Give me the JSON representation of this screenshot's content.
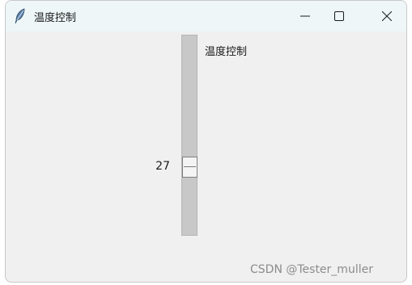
{
  "window": {
    "title": "温度控制",
    "app_icon": "feather-icon",
    "controls": {
      "minimize_icon": "minimize-icon",
      "maximize_icon": "maximize-icon",
      "close_icon": "close-icon"
    }
  },
  "scale": {
    "label": "温度控制",
    "value": "27",
    "fraction": 0.68,
    "orientation": "vertical"
  },
  "watermark": "CSDN @Tester_muller"
}
